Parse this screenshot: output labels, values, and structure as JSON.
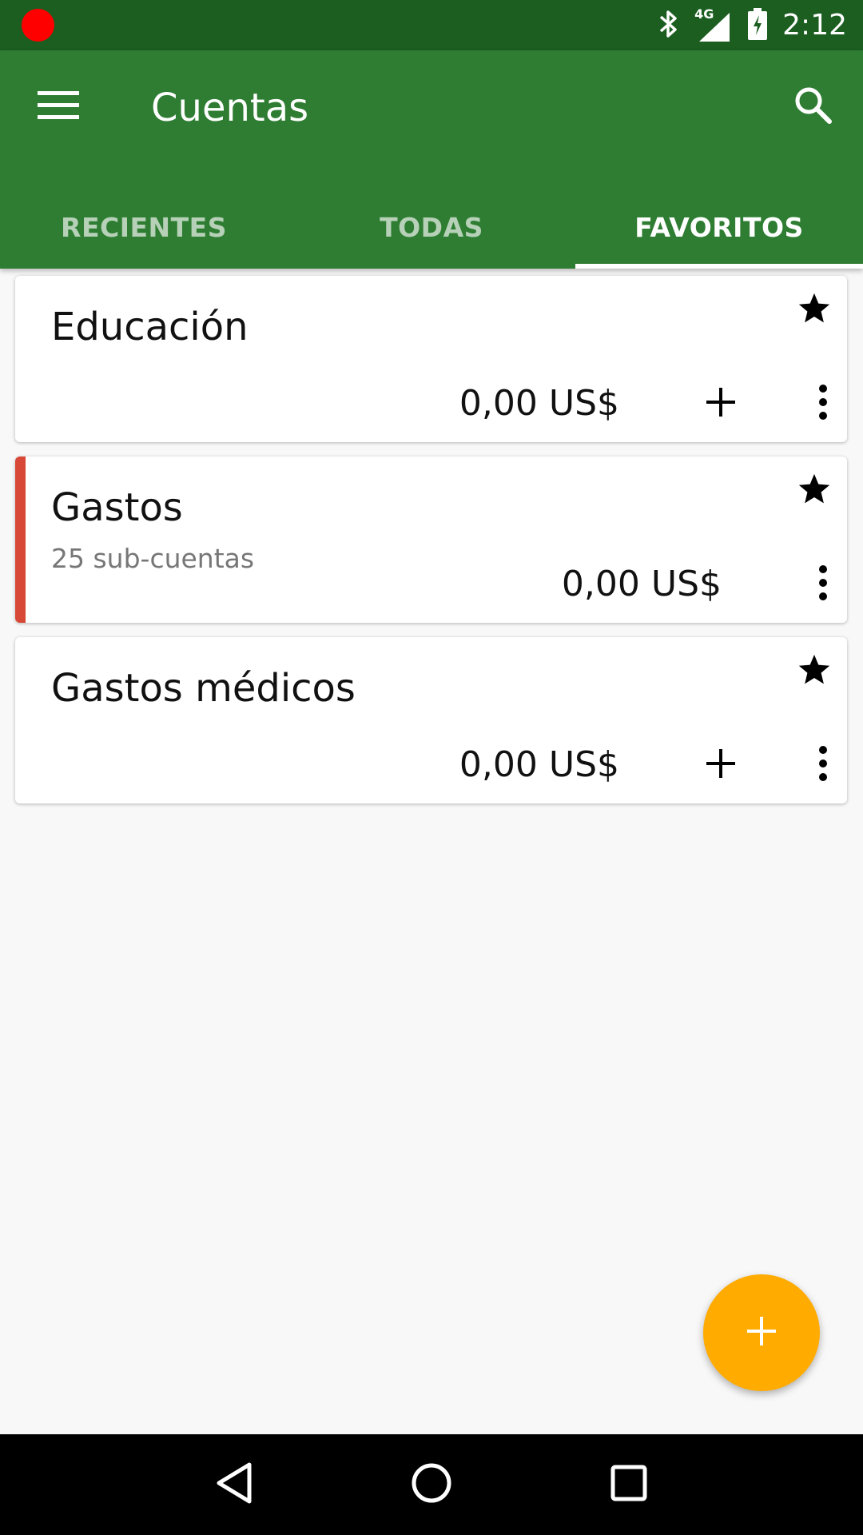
{
  "status_bar": {
    "time": "2:12",
    "network": "4G",
    "icons": [
      "recording-dot",
      "bluetooth-icon",
      "signal-icon",
      "battery-charging-icon"
    ]
  },
  "app_bar": {
    "title": "Cuentas",
    "menu_icon": "menu-icon",
    "search_icon": "search-icon"
  },
  "tabs": [
    {
      "label": "RECIENTES",
      "active": false
    },
    {
      "label": "TODAS",
      "active": false
    },
    {
      "label": "FAVORITOS",
      "active": true
    }
  ],
  "accounts": [
    {
      "name": "Educación",
      "subtitle": "",
      "balance": "0,00 US$",
      "favorite": true,
      "has_add": true,
      "accent_color": ""
    },
    {
      "name": "Gastos",
      "subtitle": "25 sub-cuentas",
      "balance": "0,00 US$",
      "favorite": true,
      "has_add": false,
      "accent_color": "#d84836"
    },
    {
      "name": "Gastos médicos",
      "subtitle": "",
      "balance": "0,00 US$",
      "favorite": true,
      "has_add": true,
      "accent_color": ""
    }
  ],
  "fab": {
    "icon": "plus-icon"
  },
  "colors": {
    "status_bar": "#1b5e20",
    "app_bar": "#2e7d32",
    "fab": "#ffab00",
    "background": "#f8f8f8"
  }
}
